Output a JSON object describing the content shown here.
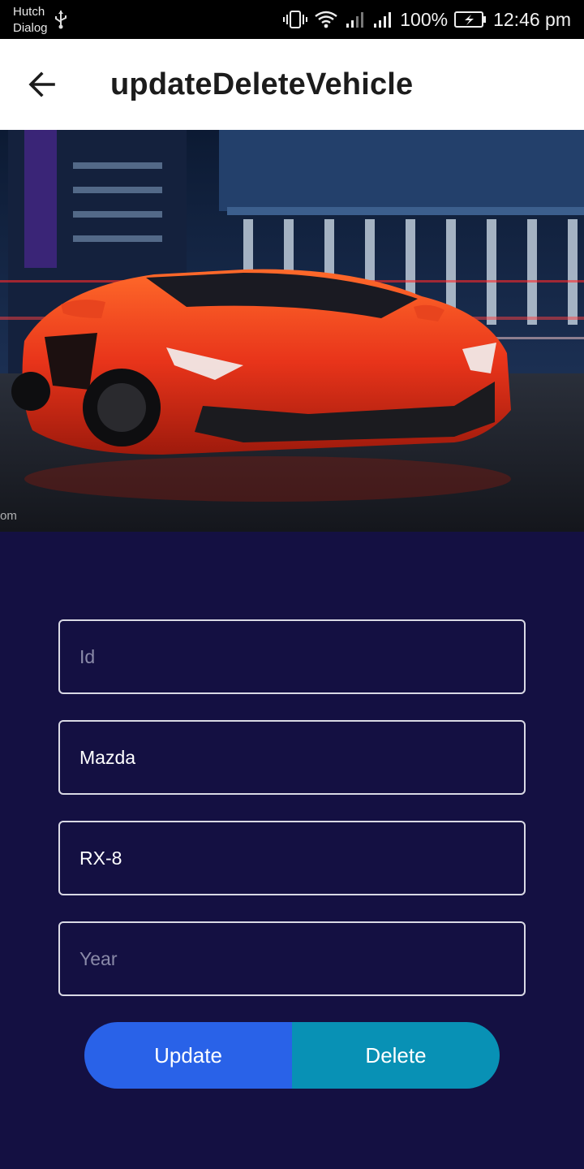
{
  "status_bar": {
    "carrier_line1": "Hutch",
    "carrier_line2": "Dialog",
    "icons": [
      "usb-icon",
      "vibrate-icon",
      "wifi-icon",
      "signal-icon",
      "signal-icon",
      "battery-charging-icon"
    ],
    "battery": "100%",
    "time": "12:46 pm"
  },
  "app_bar": {
    "back_icon": "arrow-left-icon",
    "title": "updateDeleteVehicle"
  },
  "hero": {
    "description_icon": "car-photo",
    "watermark": "om"
  },
  "form": {
    "id": {
      "value": "",
      "placeholder": "Id"
    },
    "make": {
      "value": "Mazda",
      "placeholder": ""
    },
    "model": {
      "value": "RX-8",
      "placeholder": ""
    },
    "year": {
      "value": "",
      "placeholder": "Year"
    }
  },
  "actions": {
    "update_label": "Update",
    "delete_label": "Delete"
  },
  "colors": {
    "background": "#141042",
    "app_bar": "#ffffff",
    "update_button": "#2962e8",
    "delete_button": "#0891b5",
    "field_border": "#d9d9e4"
  }
}
